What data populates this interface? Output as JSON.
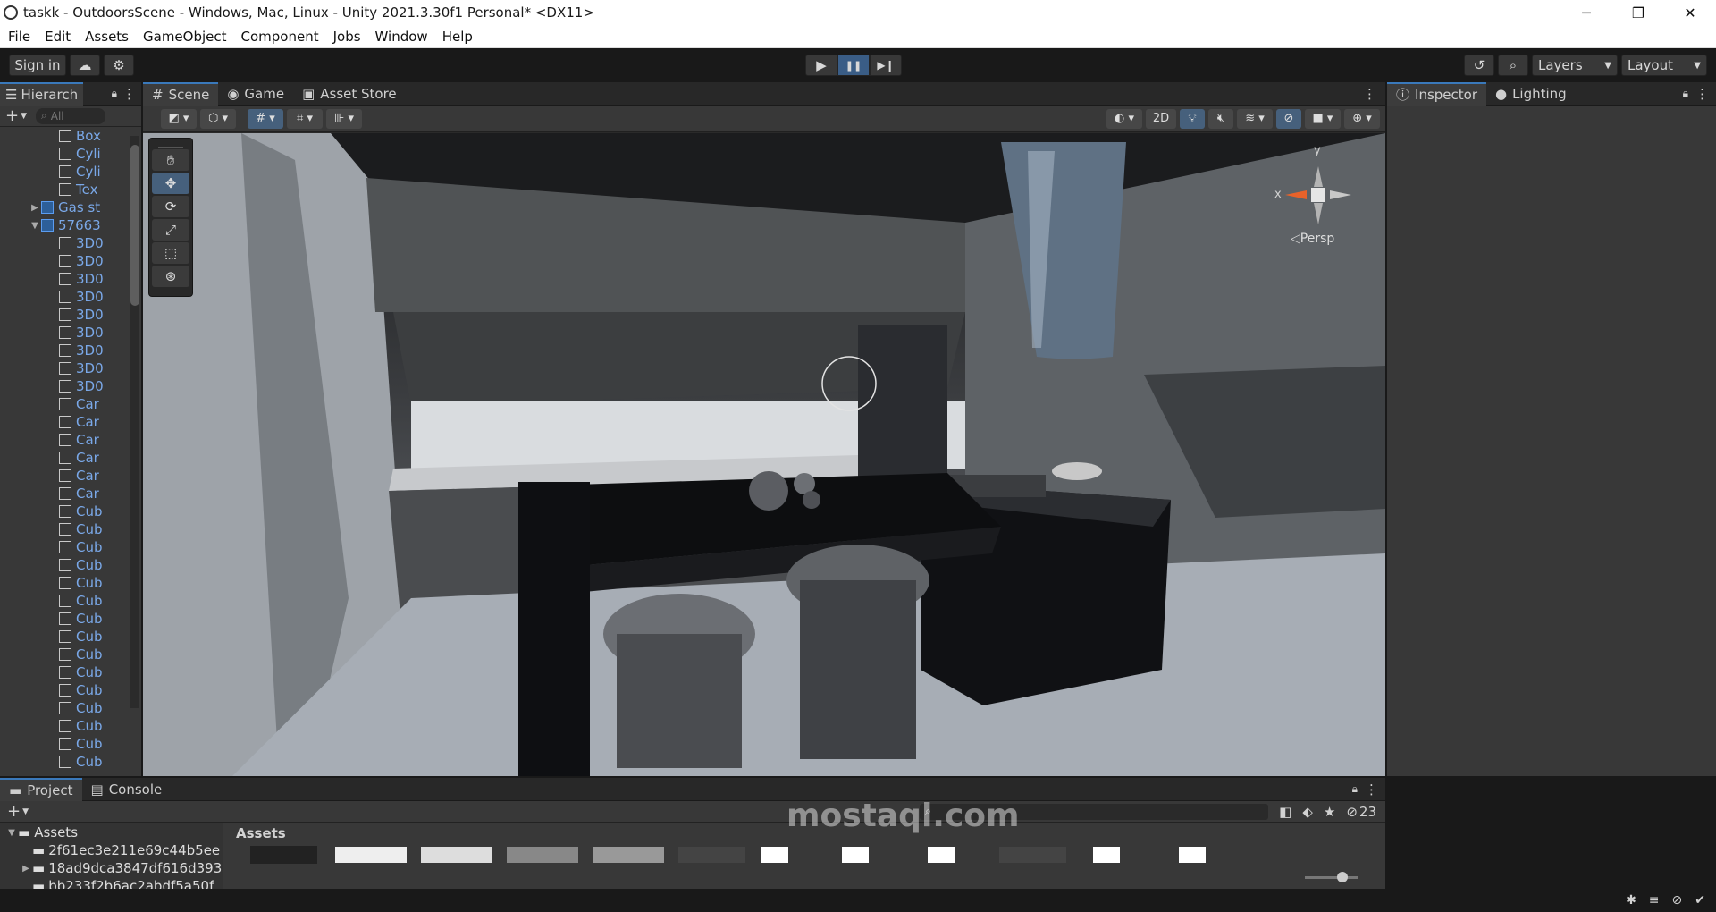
{
  "window": {
    "title": "taskk - OutdoorsScene - Windows, Mac, Linux - Unity 2021.3.30f1 Personal* <DX11>",
    "minimize": "─",
    "restore": "❐",
    "close": "✕"
  },
  "menu": [
    "File",
    "Edit",
    "Assets",
    "GameObject",
    "Component",
    "Jobs",
    "Window",
    "Help"
  ],
  "toolbar": {
    "sign_in": "Sign in",
    "play": "▶",
    "pause": "❚❚",
    "step": "▶❙",
    "layers": "Layers",
    "layout": "Layout"
  },
  "hierarchy": {
    "tab": "Hierarch",
    "search_placeholder": "All",
    "items": [
      {
        "label": "Box",
        "indent": 3,
        "icon": "cube-icon"
      },
      {
        "label": "Cyli",
        "indent": 3,
        "icon": "cube-icon"
      },
      {
        "label": "Cyli",
        "indent": 3,
        "icon": "cube-icon"
      },
      {
        "label": "Tex",
        "indent": 3,
        "icon": "cube-icon"
      },
      {
        "label": "Gas st",
        "indent": 2,
        "icon": "prefab-icon",
        "arrow": "▶"
      },
      {
        "label": "57663",
        "indent": 2,
        "icon": "prefab-icon",
        "arrow": "▼"
      },
      {
        "label": "3D0",
        "indent": 3,
        "icon": "cube-icon"
      },
      {
        "label": "3D0",
        "indent": 3,
        "icon": "cube-icon"
      },
      {
        "label": "3D0",
        "indent": 3,
        "icon": "cube-icon"
      },
      {
        "label": "3D0",
        "indent": 3,
        "icon": "cube-icon"
      },
      {
        "label": "3D0",
        "indent": 3,
        "icon": "cube-icon"
      },
      {
        "label": "3D0",
        "indent": 3,
        "icon": "cube-icon"
      },
      {
        "label": "3D0",
        "indent": 3,
        "icon": "cube-icon"
      },
      {
        "label": "3D0",
        "indent": 3,
        "icon": "cube-icon"
      },
      {
        "label": "3D0",
        "indent": 3,
        "icon": "cube-icon"
      },
      {
        "label": "Car",
        "indent": 3,
        "icon": "cube-icon"
      },
      {
        "label": "Car",
        "indent": 3,
        "icon": "cube-icon"
      },
      {
        "label": "Car",
        "indent": 3,
        "icon": "cube-icon"
      },
      {
        "label": "Car",
        "indent": 3,
        "icon": "cube-icon"
      },
      {
        "label": "Car",
        "indent": 3,
        "icon": "cube-icon"
      },
      {
        "label": "Car",
        "indent": 3,
        "icon": "cube-icon"
      },
      {
        "label": "Cub",
        "indent": 3,
        "icon": "cube-icon"
      },
      {
        "label": "Cub",
        "indent": 3,
        "icon": "cube-icon"
      },
      {
        "label": "Cub",
        "indent": 3,
        "icon": "cube-icon"
      },
      {
        "label": "Cub",
        "indent": 3,
        "icon": "cube-icon"
      },
      {
        "label": "Cub",
        "indent": 3,
        "icon": "cube-icon"
      },
      {
        "label": "Cub",
        "indent": 3,
        "icon": "cube-icon"
      },
      {
        "label": "Cub",
        "indent": 3,
        "icon": "cube-icon"
      },
      {
        "label": "Cub",
        "indent": 3,
        "icon": "cube-icon"
      },
      {
        "label": "Cub",
        "indent": 3,
        "icon": "cube-icon"
      },
      {
        "label": "Cub",
        "indent": 3,
        "icon": "cube-icon"
      },
      {
        "label": "Cub",
        "indent": 3,
        "icon": "cube-icon"
      },
      {
        "label": "Cub",
        "indent": 3,
        "icon": "cube-icon"
      },
      {
        "label": "Cub",
        "indent": 3,
        "icon": "cube-icon"
      },
      {
        "label": "Cub",
        "indent": 3,
        "icon": "cube-icon"
      },
      {
        "label": "Cub",
        "indent": 3,
        "icon": "cube-icon"
      }
    ]
  },
  "scene_tabs": {
    "scene": "Scene",
    "game": "Game",
    "asset_store": "Asset Store"
  },
  "scene_toolbar": {
    "mode_2d": "2D"
  },
  "gizmo": {
    "y": "y",
    "x": "x",
    "persp": "◁Persp"
  },
  "inspector": {
    "tab_inspector": "Inspector",
    "tab_lighting": "Lighting"
  },
  "project": {
    "tab_project": "Project",
    "tab_console": "Console",
    "folder_root": "Assets",
    "folders": [
      "2f61ec3e211e69c44b5ee",
      "18ad9dca3847df616d393",
      "bb233f2b6ac2abdf5a50f"
    ],
    "breadcrumb": "Assets",
    "hidden_count": "23"
  },
  "watermark": "mostaql.com",
  "colors": {
    "accent": "#3a79bb",
    "panel": "#383838",
    "background": "#191919"
  }
}
